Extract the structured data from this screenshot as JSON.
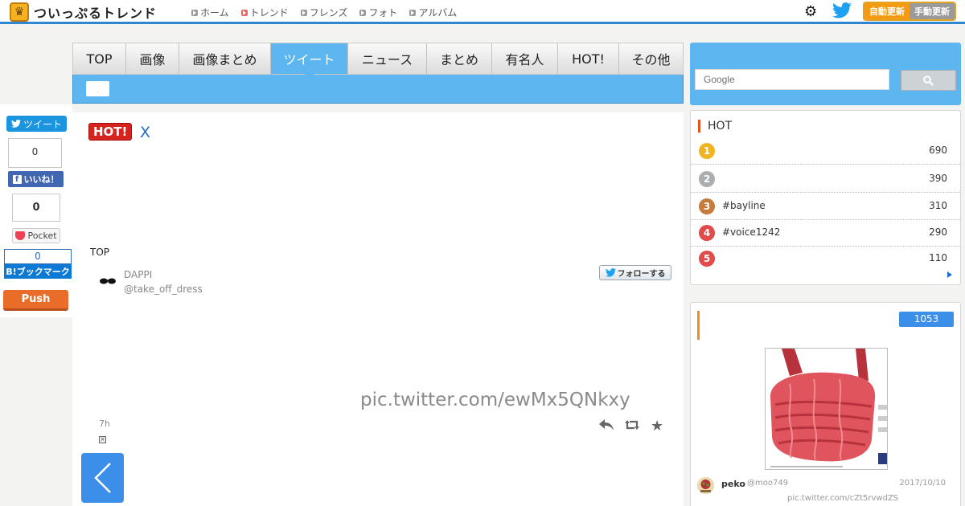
{
  "header": {
    "logo_text": "ついっぷるトレンド",
    "nav": [
      {
        "label": "ホーム"
      },
      {
        "label": "トレンド"
      },
      {
        "label": "フレンズ"
      },
      {
        "label": "フォト"
      },
      {
        "label": "アルバム"
      }
    ],
    "auto_update_label": "自動更新",
    "manual_update_label": "手動更新"
  },
  "tabs": [
    {
      "label": "TOP"
    },
    {
      "label": "画像"
    },
    {
      "label": "画像まとめ"
    },
    {
      "label": "ツイート"
    },
    {
      "label": "ニュース"
    },
    {
      "label": "まとめ"
    },
    {
      "label": "有名人"
    },
    {
      "label": "HOT!"
    },
    {
      "label": "その他"
    }
  ],
  "active_tab_index": 3,
  "share": {
    "tweet_label": "ツイート",
    "like_count": "0",
    "like_label": "いいね！",
    "pocket_count": "0",
    "pocket_label": "Pocket",
    "hatena_count": "0",
    "hatena_label": "B!ブックマーク",
    "push_label": "Push"
  },
  "main": {
    "hot_badge": "HOT!",
    "x_link": "X",
    "top_link": "TOP",
    "tweet": {
      "name": "DAPPI",
      "handle": "@take_off_dress",
      "follow_label": "フォローする",
      "pic_link": "pic.twitter.com/ewMx5QNkxy",
      "time": "7h"
    }
  },
  "search": {
    "placeholder": "Google"
  },
  "hot_panel": {
    "title": "HOT",
    "items": [
      {
        "rank": "1",
        "label": "",
        "count": "690",
        "color": "#f0b423"
      },
      {
        "rank": "2",
        "label": "",
        "count": "390",
        "color": "#a9aeb3"
      },
      {
        "rank": "3",
        "label": "#bayline",
        "count": "310",
        "color": "#c67a3c"
      },
      {
        "rank": "4",
        "label": "#voice1242",
        "count": "290",
        "color": "#e04b4b"
      },
      {
        "rank": "5",
        "label": "",
        "count": "110",
        "color": "#e04b4b"
      }
    ]
  },
  "image_panel": {
    "count": "1053",
    "user": "peko",
    "handle": "@moo749",
    "date": "2017/10/10",
    "pic_link": "pic.twitter.com/cZt5rvwdZS"
  }
}
